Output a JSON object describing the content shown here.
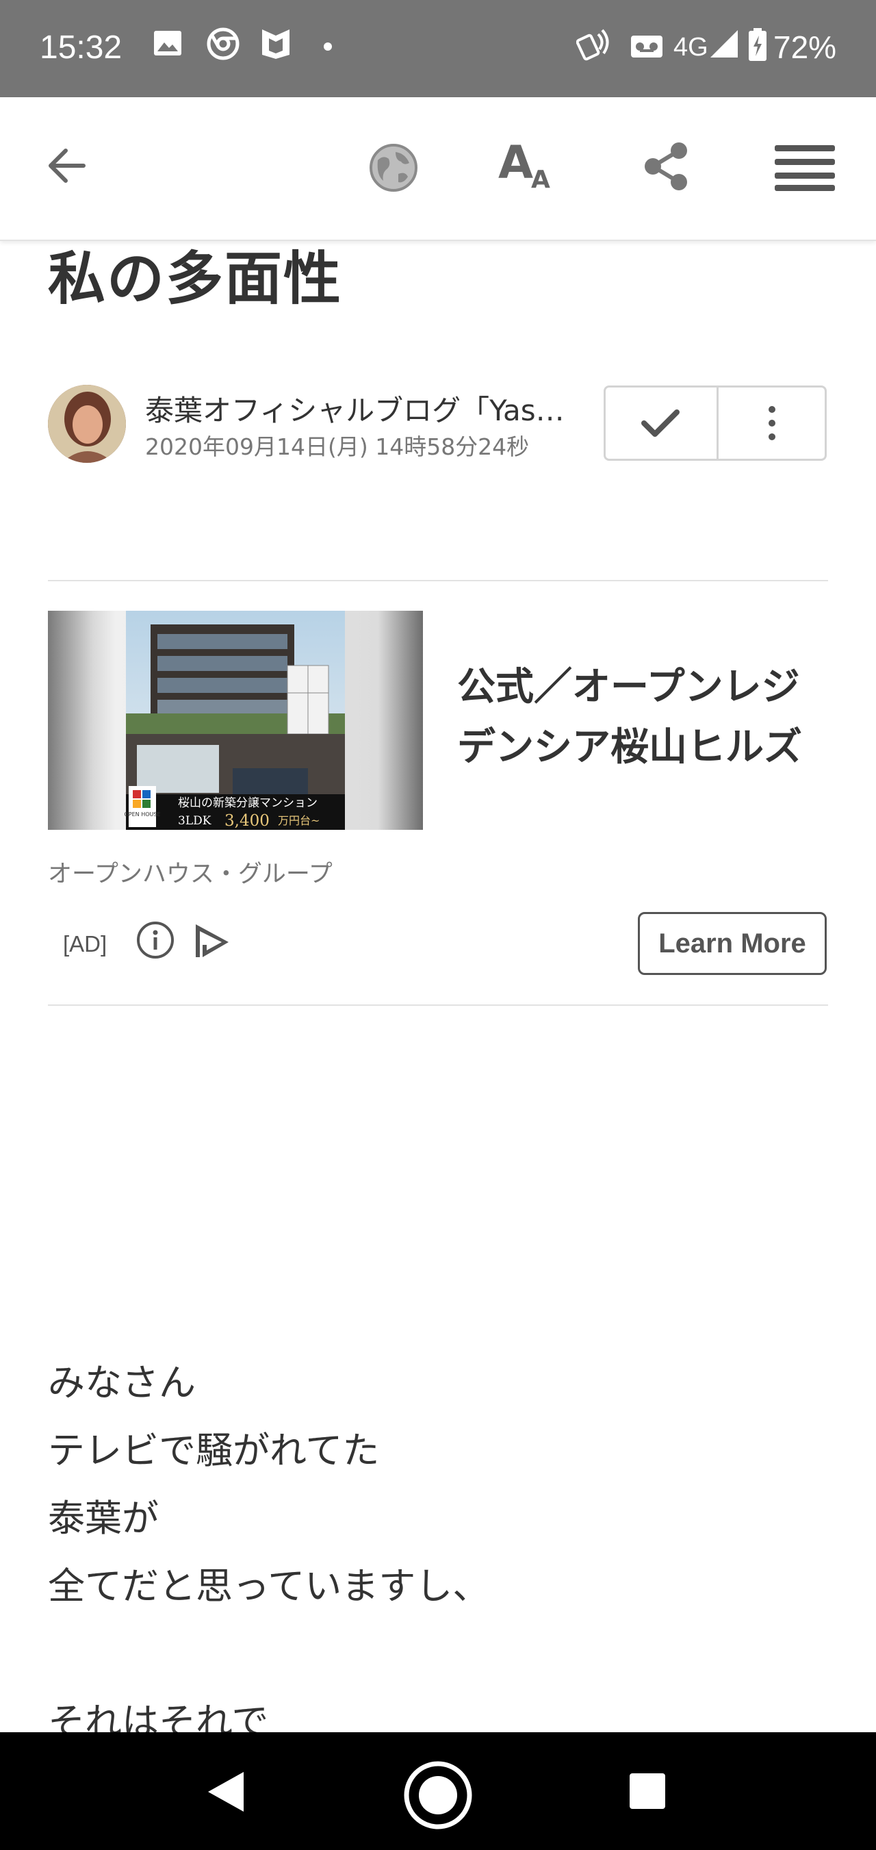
{
  "status_bar": {
    "time": "15:32",
    "network": "4G",
    "battery": "72%",
    "icons": [
      "image-icon",
      "chrome-icon",
      "ameba-shield-icon",
      "dot-icon",
      "nfc-icon",
      "voicemail-icon",
      "signal-icon",
      "battery-charging-icon"
    ]
  },
  "toolbar": {
    "icons": [
      "back-arrow-icon",
      "globe-icon",
      "text-size-icon",
      "share-icon",
      "menu-icon"
    ]
  },
  "article": {
    "title": "私の多面性",
    "author_name": "泰葉オフィシャルブログ「Yas…",
    "date": "2020年09月14日(月) 14時58分24秒"
  },
  "ad": {
    "title": "公式／オープンレジデンシア桜山ヒルズ",
    "advertiser": "オープンハウス・グループ",
    "tag": "[AD]",
    "cta": "Learn More",
    "image_caption_line1": "桜山の新築分譲マンション",
    "image_caption_line2_prefix": "3LDK",
    "image_caption_price": "3,400",
    "image_caption_suffix": "万円台~",
    "image_logo": "OPEN HOUSE"
  },
  "body": {
    "lines": [
      "みなさん",
      "テレビで騒がれてた",
      "泰葉が",
      "全てだと思っていますし、",
      "",
      "それはそれで"
    ]
  },
  "colors": {
    "status_bar_bg": "#757575",
    "nav_bar_bg": "#000000",
    "text_primary": "#333333",
    "text_secondary": "#777777"
  }
}
